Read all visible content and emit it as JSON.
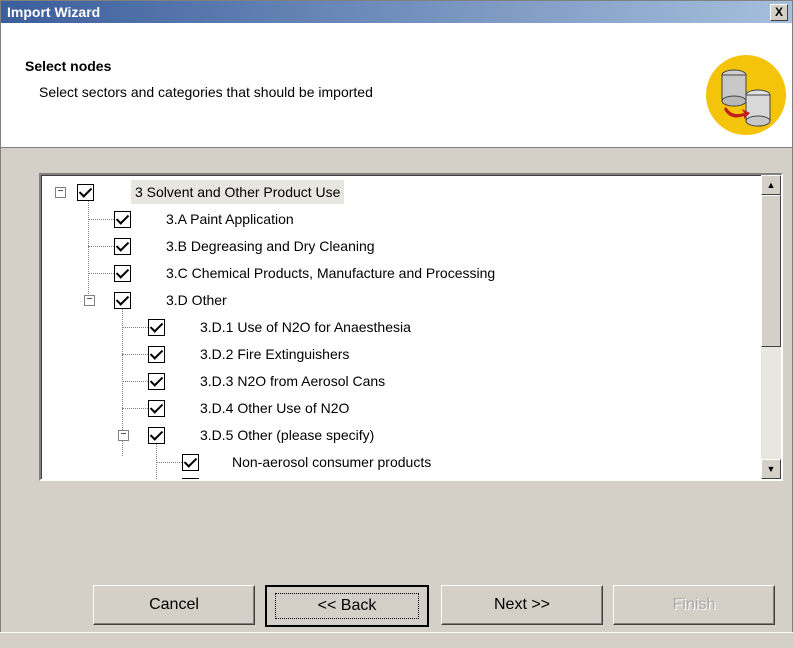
{
  "window": {
    "title": "Import Wizard",
    "close_label": "X"
  },
  "header": {
    "title": "Select nodes",
    "subtitle": "Select sectors and categories that should be imported",
    "icon": "database-import-icon",
    "accent": "#f4c40a"
  },
  "tree": {
    "nodes": [
      {
        "label": "3 Solvent and Other Product Use",
        "checked": true,
        "expandable": true,
        "expanded": true
      },
      {
        "label": "3.A Paint Application",
        "checked": true
      },
      {
        "label": "3.B Degreasing and Dry Cleaning",
        "checked": true
      },
      {
        "label": "3.C Chemical Products, Manufacture and Processing",
        "checked": true
      },
      {
        "label": "3.D Other",
        "checked": true,
        "expandable": true,
        "expanded": true
      },
      {
        "label": "3.D.1 Use of N2O for Anaesthesia",
        "checked": true
      },
      {
        "label": "3.D.2 Fire Extinguishers",
        "checked": true
      },
      {
        "label": "3.D.3 N2O from Aerosol Cans",
        "checked": true
      },
      {
        "label": "3.D.4 Other Use of N2O",
        "checked": true
      },
      {
        "label": "3.D.5 Other (please specify)",
        "checked": true,
        "expandable": true,
        "expanded": true
      },
      {
        "label": "Non-aerosol consumer products",
        "checked": true
      }
    ],
    "expander_symbol": "−"
  },
  "buttons": {
    "cancel": "Cancel",
    "back": "<< Back",
    "next": "Next >>",
    "finish": "Finish"
  }
}
